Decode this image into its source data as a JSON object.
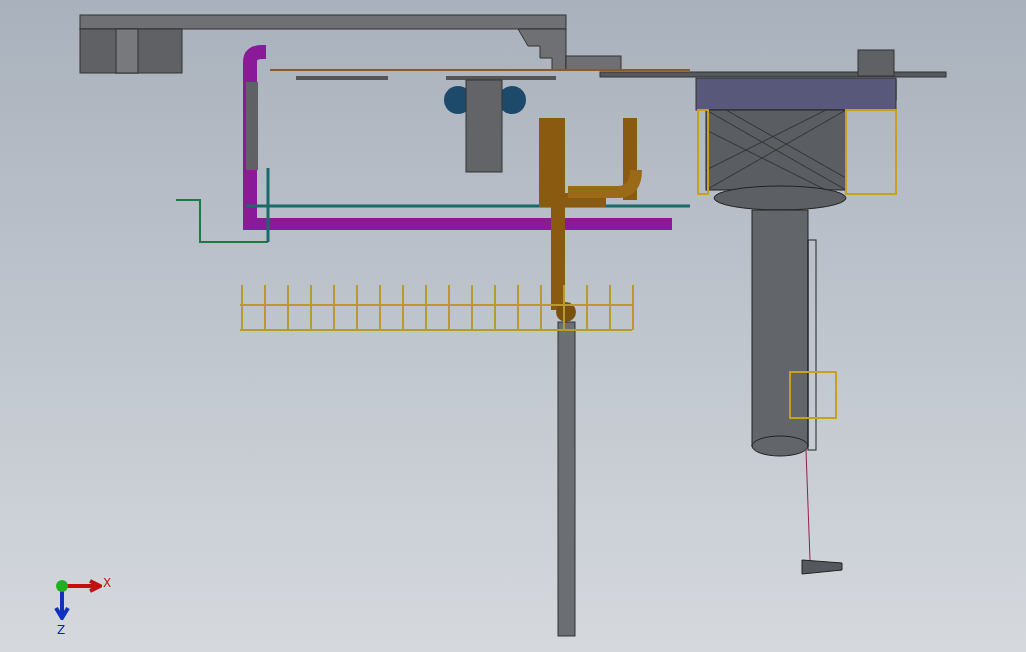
{
  "viewport": {
    "axes": [
      {
        "kind": "x",
        "label": "X"
      },
      {
        "kind": "z",
        "label": "Z"
      }
    ]
  }
}
